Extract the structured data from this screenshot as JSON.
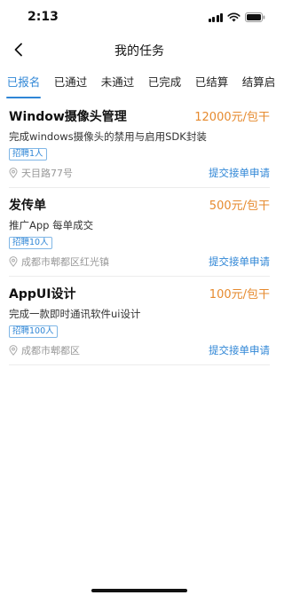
{
  "status_bar": {
    "time": "2:13"
  },
  "header": {
    "title": "我的任务",
    "back_icon": "chevron-left-icon"
  },
  "tabs": [
    {
      "label": "已报名",
      "active": true
    },
    {
      "label": "已通过",
      "active": false
    },
    {
      "label": "未通过",
      "active": false
    },
    {
      "label": "已完成",
      "active": false
    },
    {
      "label": "已结算",
      "active": false
    },
    {
      "label": "结算启",
      "active": false
    }
  ],
  "tasks": [
    {
      "title": "Window摄像头管理",
      "price": "12000元/包干",
      "description": "完成windows摄像头的禁用与启用SDK封装",
      "tag": "招聘1人",
      "location": "天目路77号",
      "action": "提交接单申请"
    },
    {
      "title": "发传单",
      "price": "500元/包干",
      "description": "推广App 每单成交",
      "tag": "招聘10人",
      "location": "成都市郫都区红光镇",
      "action": "提交接单申请"
    },
    {
      "title": "AppUI设计",
      "price": "100元/包干",
      "description": "完成一款即时通讯软件ui设计",
      "tag": "招聘100人",
      "location": "成都市郫都区",
      "action": "提交接单申请"
    }
  ],
  "colors": {
    "accent": "#2f86d6",
    "price": "#e68a2e",
    "muted": "#999999"
  }
}
